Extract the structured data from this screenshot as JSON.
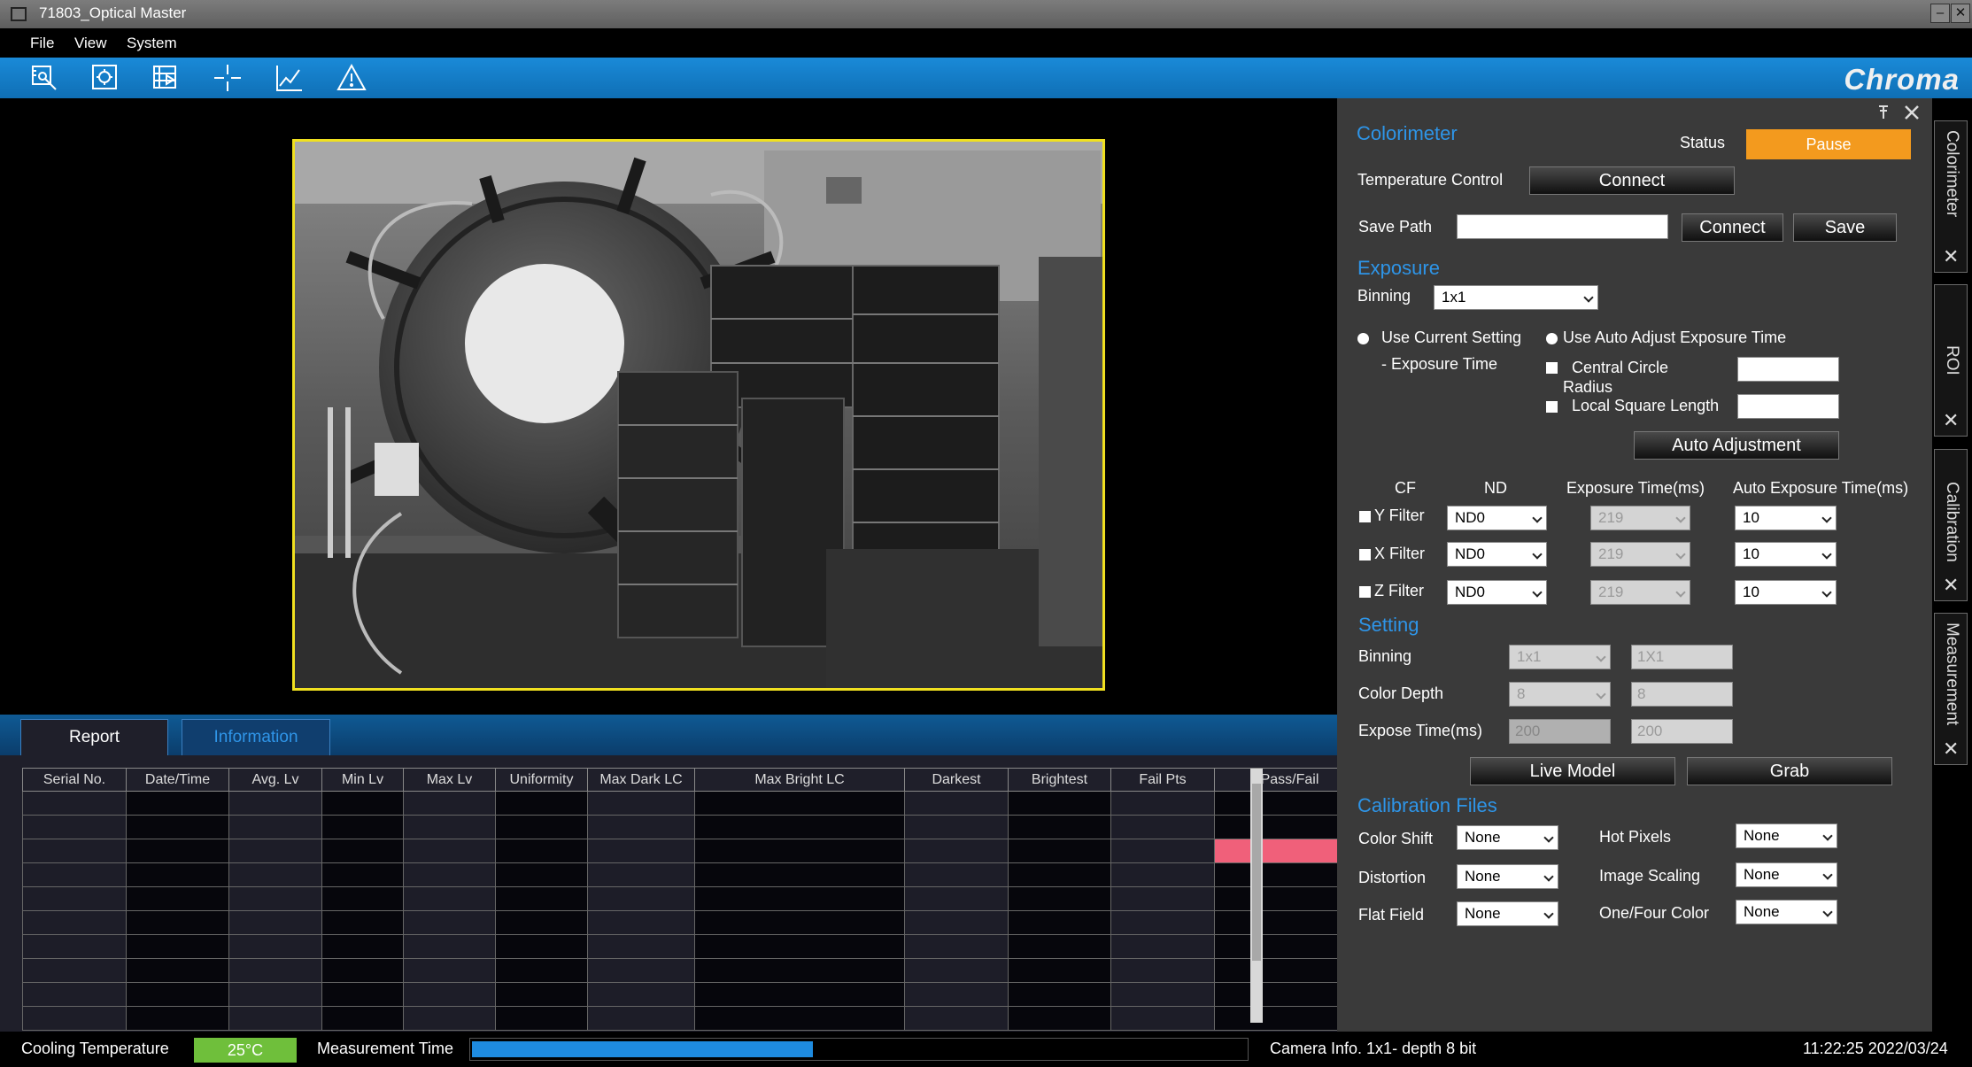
{
  "window": {
    "title": "71803_Optical Master"
  },
  "menu": [
    "File",
    "View",
    "System"
  ],
  "toolbar": {
    "icons": [
      "inspect-icon",
      "target-icon",
      "sequence-icon",
      "crosshair-icon",
      "chart-icon",
      "warning-icon"
    ],
    "logo": "Chroma"
  },
  "tabs": {
    "report": "Report",
    "information": "Information"
  },
  "report": {
    "columns": [
      "Serial No.",
      "Date/Time",
      "Avg. Lv",
      "Min Lv",
      "Max Lv",
      "Uniformity",
      "Max Dark LC",
      "Max Bright LC",
      "Darkest",
      "Brightest",
      "Fail Pts",
      "Pass/Fail"
    ],
    "row_status": [
      "pass",
      "pass",
      "fail",
      "pass",
      "pass",
      "pass",
      "pass",
      "pass",
      "pass",
      "pass"
    ]
  },
  "panel": {
    "colorimeter": {
      "title": "Colorimeter",
      "status_label": "Status",
      "status_value": "Pause",
      "status_color": "#f39a1e",
      "temp_label": "Temperature Control",
      "temp_button": "Connect",
      "save_path_label": "Save Path",
      "save_path_value": "",
      "connect_button": "Connect",
      "save_button": "Save"
    },
    "exposure": {
      "title": "Exposure",
      "binning_label": "Binning",
      "binning_value": "1x1",
      "use_current": "Use Current Setting",
      "exposure_time": "- Exposure Time",
      "use_auto": "Use Auto Adjust Exposure Time",
      "central_circle": "Central Circle",
      "radius": "Radius",
      "local_square": "Local Square Length",
      "auto_button": "Auto Adjustment"
    },
    "filters": {
      "headers": {
        "cf": "CF",
        "nd": "ND",
        "exp": "Exposure Time(ms)",
        "auto": "Auto Exposure Time(ms)"
      },
      "rows": [
        {
          "name": "Y Filter",
          "nd": "ND0",
          "exp": "219",
          "auto": "10"
        },
        {
          "name": "X Filter",
          "nd": "ND0",
          "exp": "219",
          "auto": "10"
        },
        {
          "name": "Z Filter",
          "nd": "ND0",
          "exp": "219",
          "auto": "10"
        }
      ]
    },
    "setting": {
      "title": "Setting",
      "binning_label": "Binning",
      "binning_sel": "1x1",
      "binning_val": "1X1",
      "depth_label": "Color Depth",
      "depth_sel": "8",
      "depth_val": "8",
      "expose_label": "Expose Time(ms)",
      "expose_a": "200",
      "expose_b": "200",
      "live_button": "Live Model",
      "grab_button": "Grab"
    },
    "calibration": {
      "title": "Calibration Files",
      "color_shift": "Color Shift",
      "color_shift_val": "None",
      "hot_pixels": "Hot Pixels",
      "hot_pixels_val": "None",
      "distortion": "Distortion",
      "distortion_val": "None",
      "image_scaling": "Image Scaling",
      "image_scaling_val": "None",
      "flat_field": "Flat Field",
      "flat_field_val": "None",
      "one_four": "One/Four Color",
      "one_four_val": "None"
    }
  },
  "side_tabs": [
    "Colorimeter",
    "ROI",
    "Calibration",
    "Measurement"
  ],
  "status": {
    "cooling_label": "Cooling Temperature",
    "cooling_value": "25°C",
    "measurement_label": "Measurement Time",
    "measurement_progress": 0.44,
    "camera_info": "Camera Info. 1x1- depth 8 bit",
    "datetime": "11:22:25 2022/03/24"
  }
}
